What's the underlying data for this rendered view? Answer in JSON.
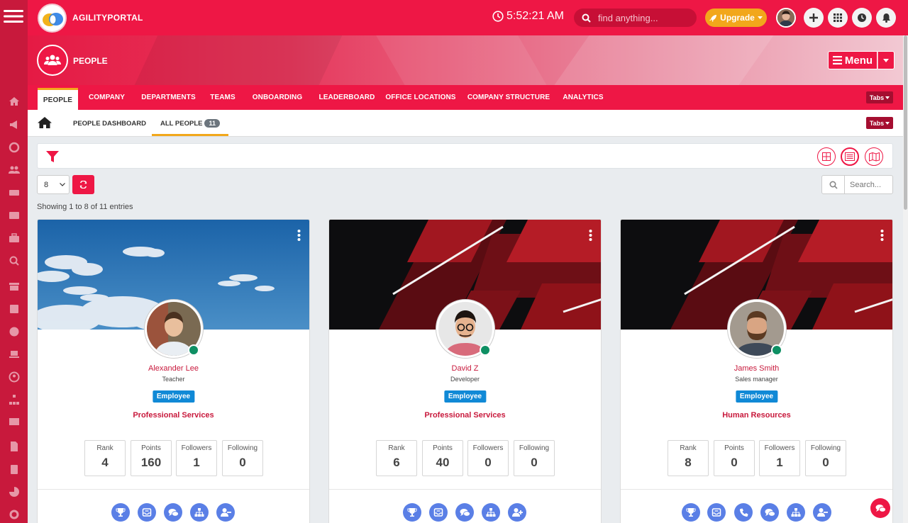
{
  "app": {
    "brand": "AGILITYPORTAL",
    "time": "5:52:21 AM"
  },
  "topbar": {
    "search_placeholder": "find anything...",
    "upgrade_label": "Upgrade"
  },
  "banner": {
    "title": "PEOPLE",
    "menu_label": "Menu"
  },
  "tabs": [
    {
      "label": "PEOPLE",
      "active": true
    },
    {
      "label": "COMPANY"
    },
    {
      "label": "DEPARTMENTS"
    },
    {
      "label": "TEAMS"
    },
    {
      "label": "ONBOARDING"
    },
    {
      "label": "LEADERBOARD"
    },
    {
      "label": "OFFICE LOCATIONS"
    },
    {
      "label": "COMPANY STRUCTURE"
    },
    {
      "label": "ANALYTICS"
    }
  ],
  "tabs_dropdown_label": "Tabs",
  "subnav": {
    "items": [
      {
        "label": "PEOPLE DASHBOARD"
      },
      {
        "label": "ALL PEOPLE",
        "badge": "11",
        "active": true
      }
    ],
    "tabs_dropdown_label": "Tabs"
  },
  "table_controls": {
    "page_size": "8",
    "search_placeholder": "Search...",
    "showing_text": "Showing 1 to 8 of 11 entries"
  },
  "people": [
    {
      "name": "Alexander Lee",
      "role": "Teacher",
      "type": "Employee",
      "department": "Professional Services",
      "stats": [
        {
          "label": "Rank",
          "value": "4"
        },
        {
          "label": "Points",
          "value": "160"
        },
        {
          "label": "Followers",
          "value": "1"
        },
        {
          "label": "Following",
          "value": "0"
        }
      ],
      "actions": [
        "trophy-icon",
        "inbox-icon",
        "chat-icon",
        "org-chart-icon",
        "unfollow-icon"
      ]
    },
    {
      "name": "David Z",
      "role": "Developer",
      "type": "Employee",
      "department": "Professional Services",
      "stats": [
        {
          "label": "Rank",
          "value": "6"
        },
        {
          "label": "Points",
          "value": "40"
        },
        {
          "label": "Followers",
          "value": "0"
        },
        {
          "label": "Following",
          "value": "0"
        }
      ],
      "actions": [
        "trophy-icon",
        "inbox-icon",
        "chat-icon",
        "org-chart-icon",
        "follow-icon"
      ]
    },
    {
      "name": "James Smith",
      "role": "Sales manager",
      "type": "Employee",
      "department": "Human Resources",
      "stats": [
        {
          "label": "Rank",
          "value": "8"
        },
        {
          "label": "Points",
          "value": "0"
        },
        {
          "label": "Followers",
          "value": "1"
        },
        {
          "label": "Following",
          "value": "0"
        }
      ],
      "actions": [
        "trophy-icon",
        "inbox-icon",
        "phone-icon",
        "chat-icon",
        "org-chart-icon",
        "unfollow-icon"
      ]
    }
  ],
  "colors": {
    "primary": "#ee1745",
    "accent": "#f2a71b",
    "badge_blue": "#1089d6",
    "online": "#0e8f63",
    "action": "#5a7fe6"
  }
}
